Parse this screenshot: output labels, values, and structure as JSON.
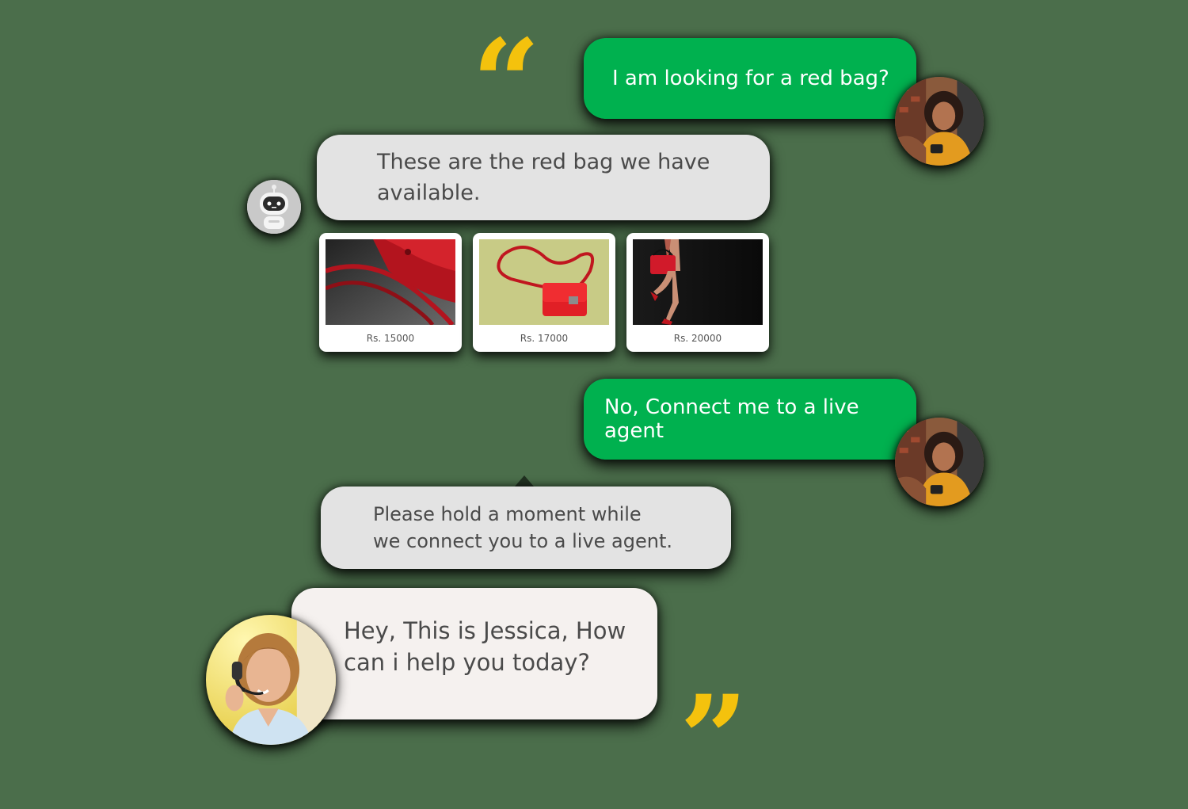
{
  "colors": {
    "background": "#4b6e4b",
    "user_bubble": "#00b14f",
    "bot_bubble": "#e3e3e3",
    "agent_bubble": "#f5f1ef",
    "quote_mark": "#f4c20d"
  },
  "quotes": {
    "open": "“",
    "close": "”"
  },
  "messages": [
    {
      "sender": "user",
      "text": "I am looking for a red bag?"
    },
    {
      "sender": "bot",
      "text": "These are the red bag we have\navailable."
    },
    {
      "sender": "user",
      "text": "No, Connect me to a live agent"
    },
    {
      "sender": "bot",
      "text": "Please hold a moment while\nwe connect you to a live agent."
    },
    {
      "sender": "agent",
      "text": "Hey, This is Jessica, How\ncan i help you today?"
    }
  ],
  "products": [
    {
      "price": "Rs. 15000",
      "image": "red-handbag-closeup"
    },
    {
      "price": "Rs. 17000",
      "image": "red-crossbody-bag"
    },
    {
      "price": "Rs. 20000",
      "image": "woman-with-red-bag"
    }
  ],
  "avatars": {
    "user": "user-avatar",
    "bot": "robot-icon",
    "agent": "agent-avatar"
  }
}
